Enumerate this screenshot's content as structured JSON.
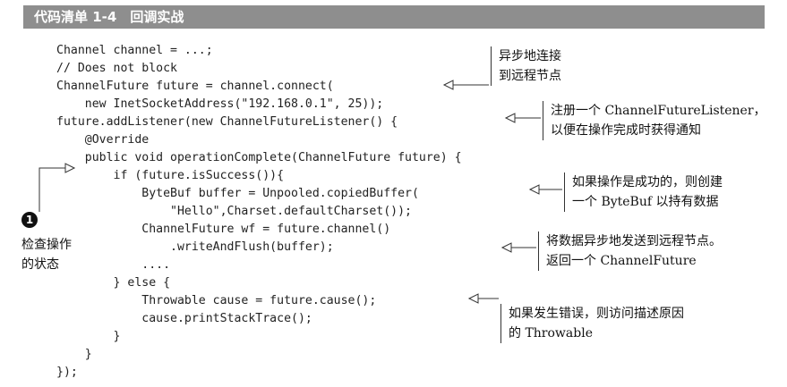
{
  "listing": {
    "title": "代码清单 1-4　回调实战"
  },
  "code": {
    "lines": [
      "Channel channel = ...;",
      "// Does not block",
      "ChannelFuture future = channel.connect(",
      "    new InetSocketAddress(\"192.168.0.1\", 25));",
      "future.addListener(new ChannelFutureListener() {",
      "    @Override",
      "    public void operationComplete(ChannelFuture future) {",
      "        if (future.isSuccess()){",
      "            ByteBuf buffer = Unpooled.copiedBuffer(",
      "                \"Hello\",Charset.defaultCharset());",
      "            ChannelFuture wf = future.channel()",
      "                .writeAndFlush(buffer);",
      "            ....",
      "        } else {",
      "            Throwable cause = future.cause();",
      "            cause.printStackTrace();",
      "        }",
      "    }",
      "});"
    ]
  },
  "annotations": {
    "a1": [
      "异步地连接",
      "到远程节点"
    ],
    "a2": [
      "注册一个 ChannelFutureListener，",
      "以便在操作完成时获得通知"
    ],
    "a3": [
      "如果操作是成功的，则创建",
      "一个 ByteBuf 以持有数据"
    ],
    "a4": [
      "将数据异步地发送到远程节点。",
      "返回一个 ChannelFuture"
    ],
    "a5": [
      "如果发生错误，则访问描述原因",
      "的 Throwable"
    ]
  },
  "callout": {
    "number": "1",
    "lines": [
      "检查操作",
      "的状态"
    ]
  }
}
